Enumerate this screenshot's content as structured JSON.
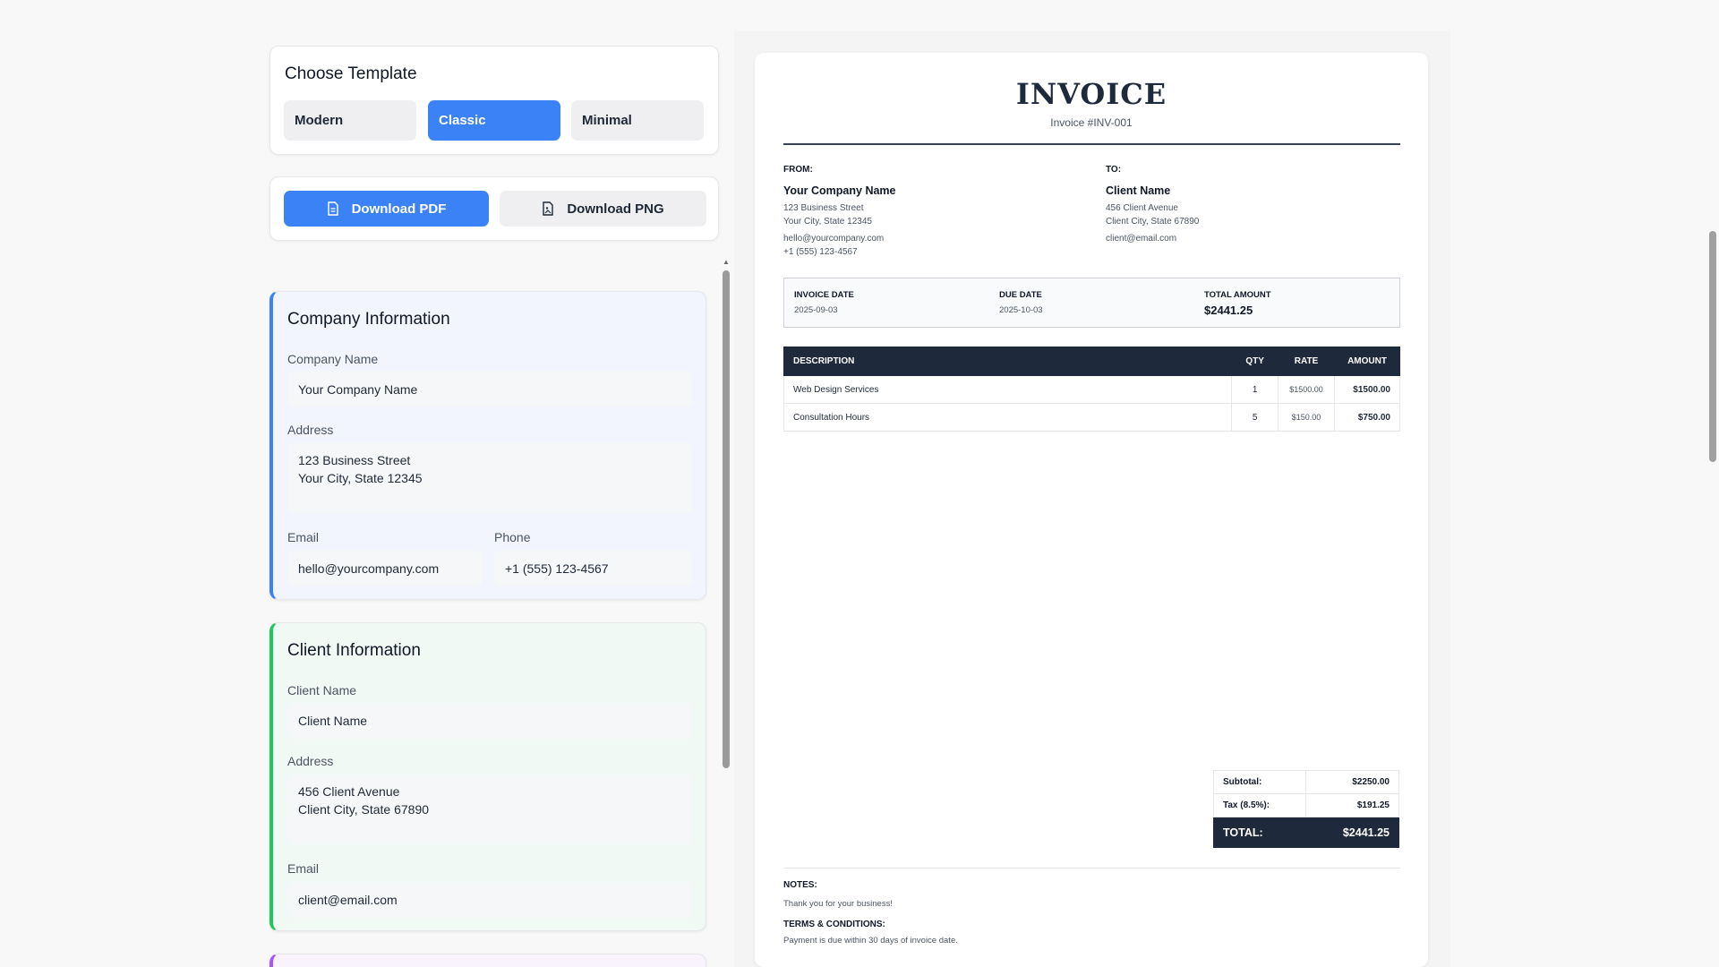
{
  "templates": {
    "title": "Choose Template",
    "options": [
      "Modern",
      "Classic",
      "Minimal"
    ],
    "selected": "Classic"
  },
  "downloads": {
    "pdf_label": "Download PDF",
    "png_label": "Download PNG"
  },
  "company": {
    "section_title": "Company Information",
    "name_label": "Company Name",
    "name_value": "Your Company Name",
    "address_label": "Address",
    "address_value": "123 Business Street\nYour City, State 12345",
    "email_label": "Email",
    "email_value": "hello@yourcompany.com",
    "phone_label": "Phone",
    "phone_value": "+1 (555) 123-4567"
  },
  "client": {
    "section_title": "Client Information",
    "name_label": "Client Name",
    "name_value": "Client Name",
    "address_label": "Address",
    "address_value": "456 Client Avenue\nClient City, State 67890",
    "email_label": "Email",
    "email_value": "client@email.com"
  },
  "invoice": {
    "title": "INVOICE",
    "number": "Invoice #INV-001",
    "from_label": "FROM:",
    "to_label": "TO:",
    "from": {
      "name": "Your Company Name",
      "address1": "123 Business Street",
      "address2": "Your City, State 12345",
      "email": "hello@yourcompany.com",
      "phone": "+1 (555) 123-4567"
    },
    "to": {
      "name": "Client Name",
      "address1": "456 Client Avenue",
      "address2": "Client City, State 67890",
      "email": "client@email.com"
    },
    "meta": {
      "invoice_date_label": "INVOICE DATE",
      "invoice_date": "2025-09-03",
      "due_date_label": "DUE DATE",
      "due_date": "2025-10-03",
      "total_label": "TOTAL AMOUNT",
      "total": "$2441.25"
    },
    "columns": [
      "DESCRIPTION",
      "QTY",
      "RATE",
      "AMOUNT"
    ],
    "items": [
      {
        "description": "Web Design Services",
        "qty": "1",
        "rate": "$1500.00",
        "amount": "$1500.00"
      },
      {
        "description": "Consultation Hours",
        "qty": "5",
        "rate": "$150.00",
        "amount": "$750.00"
      }
    ],
    "totals": {
      "subtotal_label": "Subtotal:",
      "subtotal": "$2250.00",
      "tax_label": "Tax (8.5%):",
      "tax": "$191.25",
      "total_label": "TOTAL:",
      "total": "$2441.25"
    },
    "notes_label": "NOTES:",
    "notes": "Thank you for your business!",
    "terms_label": "TERMS & CONDITIONS:",
    "terms": "Payment is due within 30 days of invoice date."
  },
  "colors": {
    "accent": "#3b82f6",
    "company_border": "#3b82f6",
    "client_border": "#22c55e",
    "third_border": "#a855f7",
    "invoice_dark": "#1e293b"
  }
}
